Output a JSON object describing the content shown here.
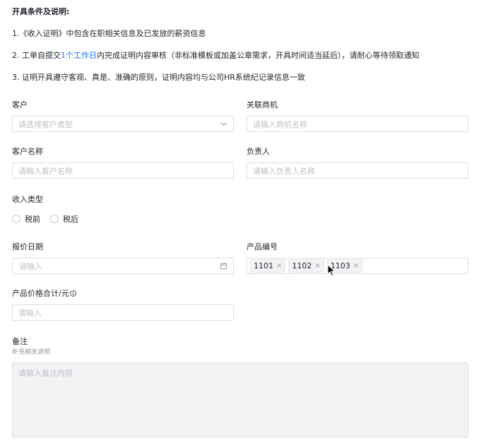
{
  "intro": {
    "title": "开具条件及说明:",
    "item1": "1.《收入证明》中包含在职相关信息及已发放的薪资信息",
    "item2_before": "2. 工单自提交",
    "item2_highlight": "1个工作日",
    "item2_after": "内完成证明内容审核（非标准模板或加盖公章需求，开具时间适当延后），请耐心等待领取通知",
    "item3": "3. 证明开具遵守客观、真是、准确的原则，证明内容均与公司HR系统纪记录信息一致"
  },
  "form": {
    "customer": {
      "label": "客户",
      "placeholder": "请选择客户类型"
    },
    "opportunity": {
      "label": "关联商机",
      "placeholder": "请输入商机名称"
    },
    "customer_name": {
      "label": "客户名称",
      "placeholder": "请输入客户名称"
    },
    "owner": {
      "label": "负责人",
      "placeholder": "请输入负责人名称"
    },
    "income_type": {
      "label": "收入类型",
      "options": [
        "税前",
        "税后"
      ]
    },
    "quote_date": {
      "label": "报价日期",
      "placeholder": "请输入"
    },
    "product_code": {
      "label": "产品编号",
      "tags": [
        "1101",
        "1102",
        "1103"
      ]
    },
    "price_total": {
      "label": "产品价格合计/元",
      "placeholder": "请输入"
    },
    "remark": {
      "label": "备注",
      "sub": "补充相关说明",
      "placeholder": "请输入备注内容"
    }
  },
  "colors": {
    "accent": "#1677ff",
    "border": "#dcdfe6",
    "placeholder": "#bbbfc4"
  }
}
